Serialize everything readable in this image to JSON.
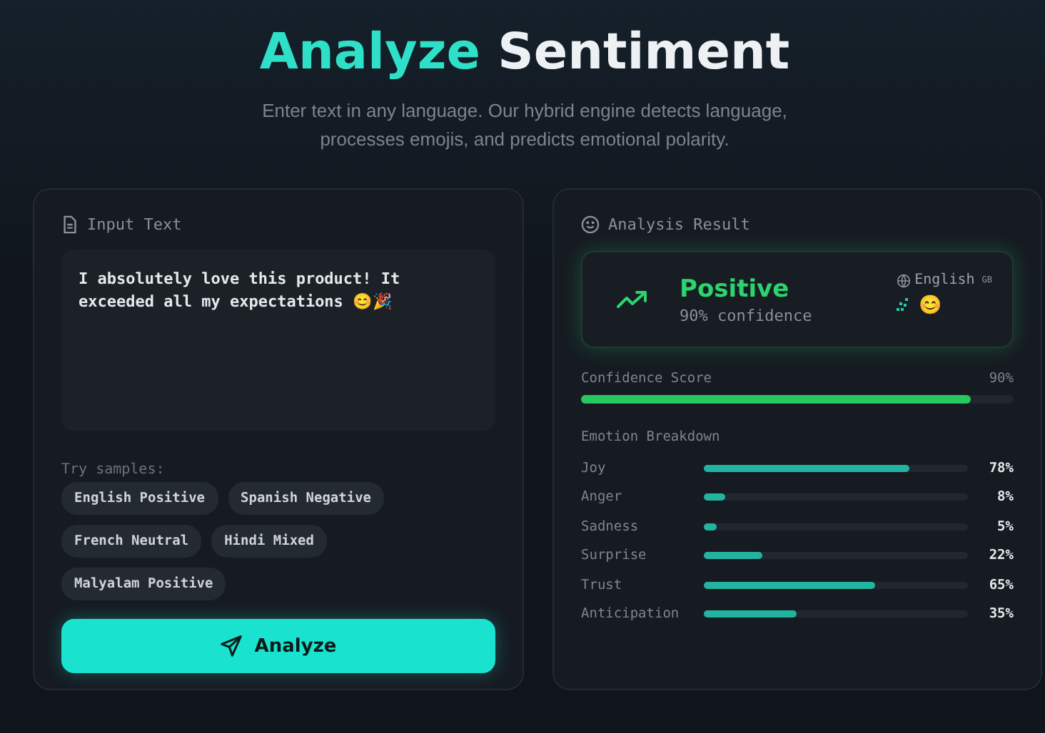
{
  "header": {
    "title_accent": "Analyze",
    "title_rest": "Sentiment",
    "subtitle": "Enter text in any language. Our hybrid engine detects language, processes emojis, and predicts emotional polarity."
  },
  "input_panel": {
    "heading": "Input Text",
    "text": "I absolutely love this product! It exceeded all my expectations 😊🎉",
    "samples_label": "Try samples:",
    "samples": [
      "English Positive",
      "Spanish Negative",
      "French Neutral",
      "Hindi Mixed",
      "Malyalam Positive"
    ],
    "button": "Analyze"
  },
  "result_panel": {
    "heading": "Analysis Result",
    "sentiment": "Positive",
    "confidence_text": "90% confidence",
    "language": "English",
    "flag": "GB",
    "emoji": "😊",
    "confidence": {
      "label": "Confidence Score",
      "value": "90%",
      "level": 0.9
    },
    "emotions_label": "Emotion Breakdown",
    "emotions": [
      {
        "name": "Joy",
        "level": 0.78,
        "reading": "78%"
      },
      {
        "name": "Anger",
        "level": 0.08,
        "reading": "8%"
      },
      {
        "name": "Sadness",
        "level": 0.05,
        "reading": "5%"
      },
      {
        "name": "Surprise",
        "level": 0.22,
        "reading": "22%"
      },
      {
        "name": "Trust",
        "level": 0.65,
        "reading": "65%"
      },
      {
        "name": "Anticipation",
        "level": 0.35,
        "reading": "35%"
      }
    ]
  }
}
